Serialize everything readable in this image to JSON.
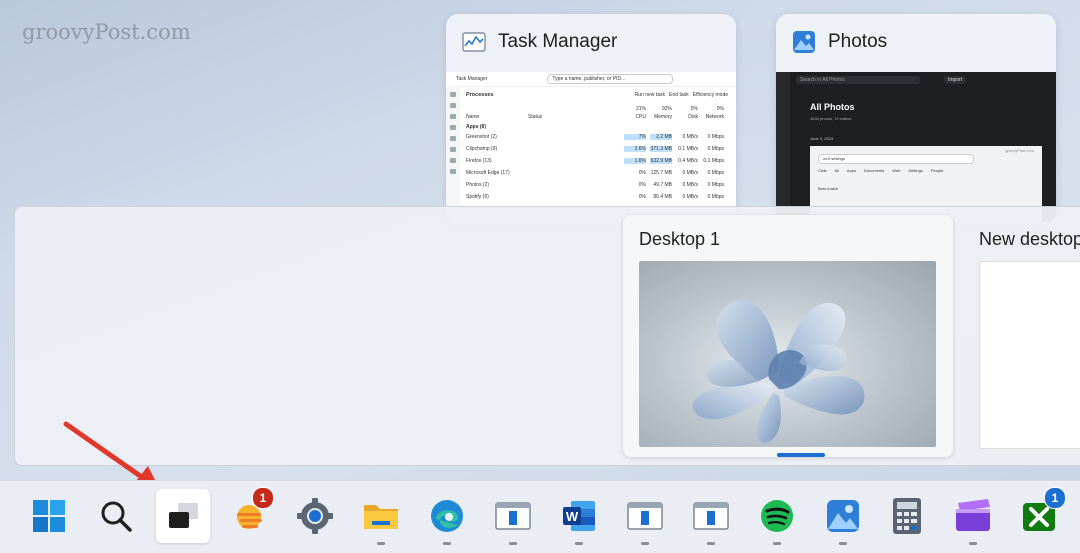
{
  "watermark": "groovyPost.com",
  "windows": {
    "task_manager": {
      "title": "Task Manager",
      "preview": {
        "app_title": "Task Manager",
        "search_placeholder": "Type a name, publisher, or PID...",
        "section": "Processes",
        "run_task": "Run new task",
        "end_task": "End task",
        "efficiency": "Efficiency mode",
        "col_name": "Name",
        "col_status": "Status",
        "cpu": "21%",
        "memory": "92%",
        "disk": "5%",
        "network": "0%",
        "cpu_label": "CPU",
        "memory_label": "Memory",
        "disk_label": "Disk",
        "network_label": "Network",
        "group": "Apps (8)",
        "rows": [
          {
            "name": "Greenshot (2)",
            "cpu": "7%",
            "mem": "2.2 MB",
            "disk": "0 MB/s",
            "net": "0 Mbps"
          },
          {
            "name": "Clipchamp (9)",
            "cpu": "2.6%",
            "mem": "371.3 MB",
            "disk": "0.1 MB/s",
            "net": "0 Mbps"
          },
          {
            "name": "Firefox (13)",
            "cpu": "1.6%",
            "mem": "632.9 MB",
            "disk": "0.4 MB/s",
            "net": "0.1 Mbps"
          },
          {
            "name": "Microsoft Edge (17)",
            "cpu": "0%",
            "mem": "125.7 MB",
            "disk": "0 MB/s",
            "net": "0 Mbps"
          },
          {
            "name": "Photos (2)",
            "cpu": "0%",
            "mem": "49.7 MB",
            "disk": "0 MB/s",
            "net": "0 Mbps"
          },
          {
            "name": "Spotify (6)",
            "cpu": "0%",
            "mem": "80.4 MB",
            "disk": "0 MB/s",
            "net": "0 Mbps"
          }
        ]
      }
    },
    "photos": {
      "title": "Photos",
      "preview": {
        "search_placeholder": "Search in All Photos",
        "import": "Import",
        "heading": "All Photos",
        "subheading": "4634 photos, 10 videos",
        "date": "June 3, 2023",
        "inner_search": "wi-fi settings",
        "inner_watermark": "groovyPost.com",
        "tabs": [
          "Chat",
          "All",
          "Apps",
          "Documents",
          "Web",
          "Settings",
          "People"
        ],
        "best_match": "Best match"
      }
    }
  },
  "task_view": {
    "desktops": [
      {
        "label": "Desktop 1"
      },
      {
        "label": "New desktop"
      }
    ]
  },
  "taskbar": {
    "items": [
      {
        "name": "start-button",
        "icon": "windows-logo"
      },
      {
        "name": "search-button",
        "icon": "search-icon"
      },
      {
        "name": "task-view-button",
        "icon": "task-view-icon",
        "active": true
      },
      {
        "name": "widgets-button",
        "icon": "weather-icon",
        "badge": "1"
      },
      {
        "name": "settings-button",
        "icon": "gear-icon"
      },
      {
        "name": "file-explorer-button",
        "icon": "folder-icon"
      },
      {
        "name": "edge-button",
        "icon": "edge-icon"
      },
      {
        "name": "window-app-button-1",
        "icon": "window-icon"
      },
      {
        "name": "word-button",
        "icon": "word-icon",
        "label": "W"
      },
      {
        "name": "window-app-button-2",
        "icon": "window-icon"
      },
      {
        "name": "window-app-button-3",
        "icon": "window-icon"
      },
      {
        "name": "spotify-button",
        "icon": "spotify-icon"
      },
      {
        "name": "photos-button",
        "icon": "photos-icon"
      },
      {
        "name": "calculator-button",
        "icon": "calculator-icon"
      },
      {
        "name": "clipchamp-button",
        "icon": "clipchamp-icon"
      },
      {
        "name": "xbox-button",
        "icon": "xbox-icon",
        "badge": "1"
      }
    ]
  },
  "colors": {
    "accent": "#1a6fd0",
    "badge_red": "#c42b1c",
    "badge_blue": "#1a6fd0",
    "annotation_arrow": "#e0392b"
  }
}
